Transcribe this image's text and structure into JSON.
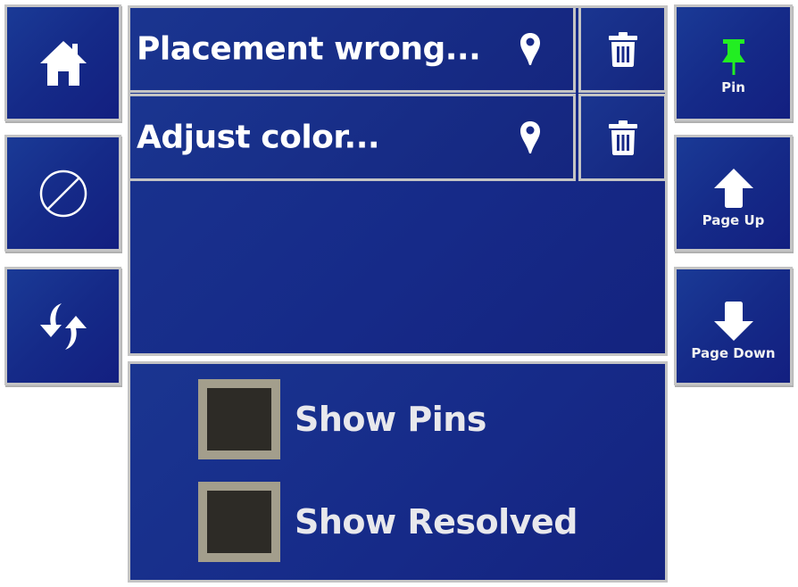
{
  "left_toolbar": {
    "buttons": [
      {
        "name": "home",
        "icon": "home-icon"
      },
      {
        "name": "cancel",
        "icon": "prohibited-icon"
      },
      {
        "name": "sync",
        "icon": "refresh-icon"
      }
    ]
  },
  "right_toolbar": {
    "pin_label": "Pin",
    "pin_icon_color": "#22ee22",
    "page_up_label": "Page Up",
    "page_down_label": "Page Down"
  },
  "issues": {
    "items": [
      {
        "title": "Placement wrong...",
        "location_icon": "map-pin-icon",
        "delete_icon": "trash-icon"
      },
      {
        "title": "Adjust color...",
        "location_icon": "map-pin-icon",
        "delete_icon": "trash-icon"
      }
    ]
  },
  "filters": {
    "show_pins_label": "Show Pins",
    "show_pins_checked": false,
    "show_resolved_label": "Show Resolved",
    "show_resolved_checked": false
  },
  "colors": {
    "tile_bg": "#152a88",
    "tile_border": "#c4c4c4",
    "checkbox_border": "#a39e8c",
    "checkbox_fill": "#2d2b26"
  }
}
